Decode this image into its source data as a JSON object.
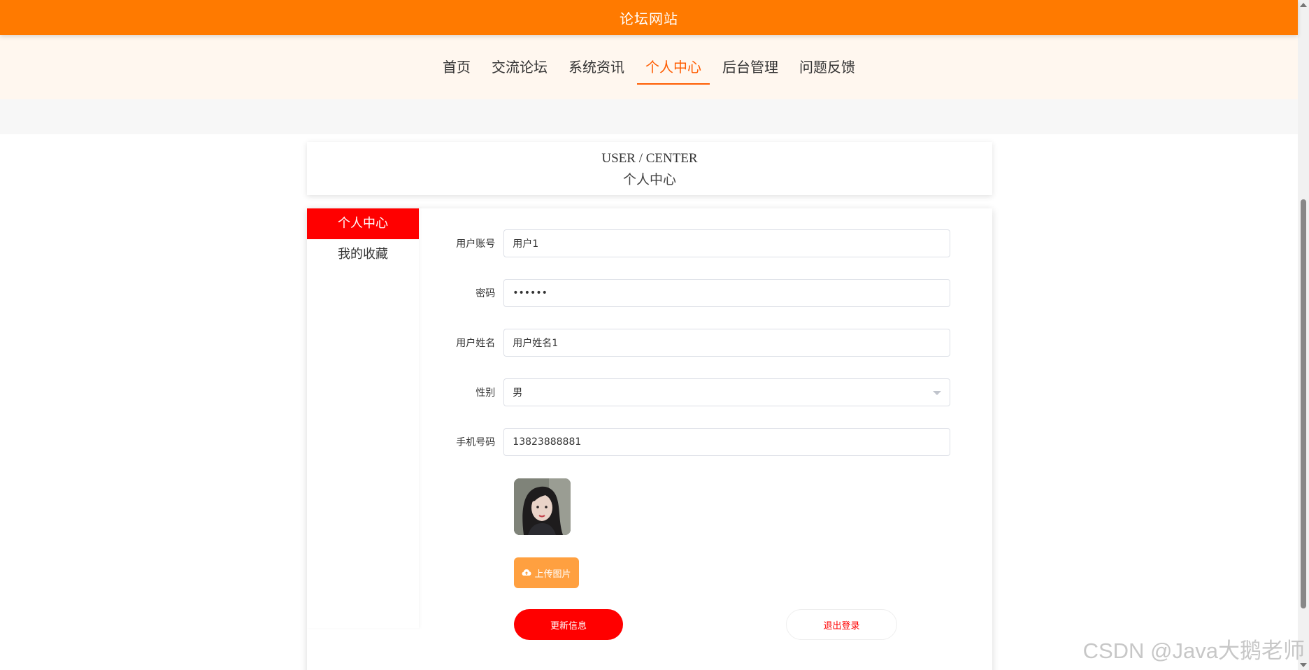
{
  "header": {
    "site_title": "论坛网站"
  },
  "nav": {
    "items": [
      {
        "label": "首页"
      },
      {
        "label": "交流论坛"
      },
      {
        "label": "系统资讯"
      },
      {
        "label": "个人中心"
      },
      {
        "label": "后台管理"
      },
      {
        "label": "问题反馈"
      }
    ],
    "active_index": 3
  },
  "page_title": {
    "en": "USER / CENTER",
    "zh": "个人中心"
  },
  "sidebar": {
    "items": [
      {
        "label": "个人中心"
      },
      {
        "label": "我的收藏"
      }
    ],
    "active_index": 0
  },
  "form": {
    "account": {
      "label": "用户账号",
      "value": "用户1"
    },
    "password": {
      "label": "密码",
      "value": "••••••"
    },
    "name": {
      "label": "用户姓名",
      "value": "用户姓名1"
    },
    "gender": {
      "label": "性别",
      "value": "男"
    },
    "phone": {
      "label": "手机号码",
      "value": "13823888881"
    }
  },
  "upload": {
    "label": "上传图片",
    "icon": "cloud-upload-icon"
  },
  "actions": {
    "update_label": "更新信息",
    "logout_label": "退出登录"
  },
  "watermark": "CSDN @Java大鹅老师",
  "colors": {
    "brand": "#ff7a00",
    "nav_bg": "#fff7ef",
    "active_nav": "#ff5c00",
    "primary_button": "#ff0000",
    "upload_button": "#ffa040"
  }
}
